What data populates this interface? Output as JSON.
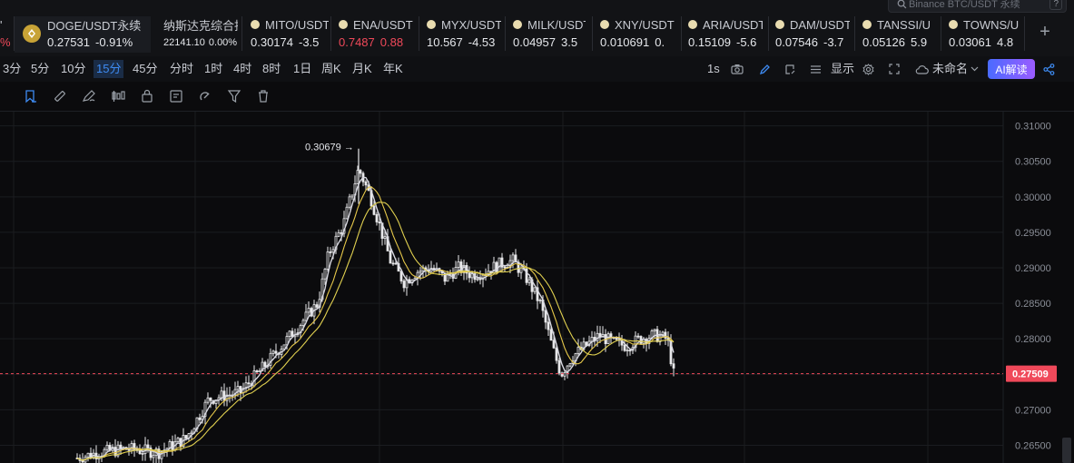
{
  "search": {
    "placeholder": "Binance BTC/USDT 永续",
    "shortcut": "?"
  },
  "tickers": [
    {
      "symbol": "DOGE/USDT永续",
      "price": "0.27531",
      "change": "-0.91%",
      "change_color": "#e6e8ec",
      "active": true
    },
    {
      "symbol": "纳斯达克综合指",
      "price": "22141.10",
      "change": "0.00%",
      "change_color": "#e6e8ec"
    },
    {
      "symbol": "MITO/USDT",
      "price": "0.30174",
      "change": "-3.5",
      "change_color": "#e6e8ec"
    },
    {
      "symbol": "ENA/USDT",
      "price": "0.7487",
      "change": "0.88",
      "change_color": "#f0495a",
      "price_color": "#f0495a"
    },
    {
      "symbol": "MYX/USDT",
      "price": "10.567",
      "change": "-4.53",
      "change_color": "#e6e8ec"
    },
    {
      "symbol": "MILK/USDT",
      "price": "0.04957",
      "change": "3.5",
      "change_color": "#e6e8ec"
    },
    {
      "symbol": "XNY/USDT",
      "price": "0.010691",
      "change": "0.",
      "change_color": "#e6e8ec"
    },
    {
      "symbol": "ARIA/USDT",
      "price": "0.15109",
      "change": "-5.6",
      "change_color": "#e6e8ec"
    },
    {
      "symbol": "DAM/USDT",
      "price": "0.07546",
      "change": "-3.7",
      "change_color": "#e6e8ec"
    },
    {
      "symbol": "TANSSI/U",
      "price": "0.05126",
      "change": "5.9",
      "change_color": "#e6e8ec"
    },
    {
      "symbol": "TOWNS/U",
      "price": "0.03061",
      "change": "4.8",
      "change_color": "#e6e8ec"
    }
  ],
  "intervals": [
    "3分",
    "5分",
    "10分",
    "15分",
    "45分",
    "分时",
    "1时",
    "4时",
    "8时",
    "1日",
    "周K",
    "月K",
    "年K"
  ],
  "active_interval": "15分",
  "toolbar_right": {
    "refresh": "1s",
    "display_label": "显示",
    "layout_name": "未命名",
    "ai_label": "AI解读"
  },
  "chart_data": {
    "type": "candlestick",
    "y_ticks": [
      "0.31000",
      "0.30500",
      "0.30000",
      "0.29500",
      "0.29000",
      "0.28500",
      "0.28000",
      "0.27500",
      "0.27000",
      "0.26500"
    ],
    "ylim": [
      0.2625,
      0.312
    ],
    "high_label": "0.30679",
    "last_price": "0.27509",
    "last_price_value": 0.27509,
    "colors": {
      "up": "#e8e8ea",
      "down": "#e8e8ea",
      "ma_fast": "#d8d8e0",
      "ma_mid": "#e6c84a",
      "ma_slow": "#e0d050",
      "price_line": "#f0495a",
      "grid": "#1b1c20"
    }
  }
}
